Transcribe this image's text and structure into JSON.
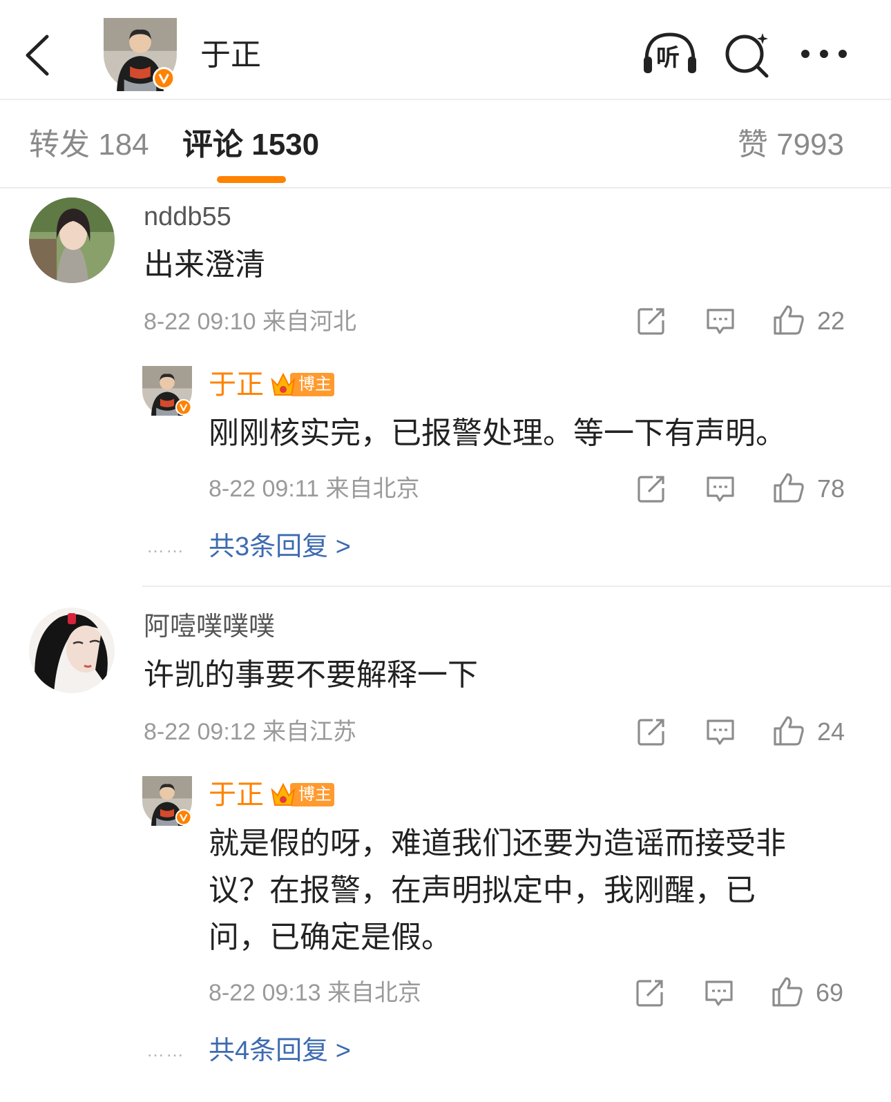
{
  "header": {
    "title": "于正",
    "back_icon": "chevron-left-icon",
    "listen_icon_label": "听",
    "search_icon": "search-icon",
    "more_icon": "more-icon"
  },
  "tabs": {
    "repost": "转发 184",
    "comments": "评论 1530",
    "likes": "赞 7993",
    "active_color": "#ff8200"
  },
  "comments": [
    {
      "username": "nddb55",
      "text": "出来澄清",
      "meta": "8-22 09:10 来自河北",
      "likes": "22",
      "reply": {
        "username": "于正",
        "badge": "博主",
        "text_lines": [
          "刚刚核实完，已报警处理。等一下有声明。"
        ],
        "meta": "8-22 09:11 来自北京",
        "likes": "78"
      },
      "more_replies": "共3条回复 >"
    },
    {
      "username": "阿噎噗噗噗",
      "text": "许凯的事要不要解释一下",
      "meta": "8-22 09:12 来自江苏",
      "likes": "24",
      "reply": {
        "username": "于正",
        "badge": "博主",
        "text_lines": [
          "就是假的呀，难道我们还要为造谣而接受非",
          "议？在报警，在声明拟定中，我刚醒，已",
          "问，已确定是假。"
        ],
        "meta": "8-22 09:13 来自北京",
        "likes": "69"
      },
      "more_replies": "共4条回复 >"
    }
  ],
  "dots": "……",
  "colors": {
    "link": "#3d6bb0",
    "accent": "#ff8200",
    "meta": "#9a9a9a"
  }
}
